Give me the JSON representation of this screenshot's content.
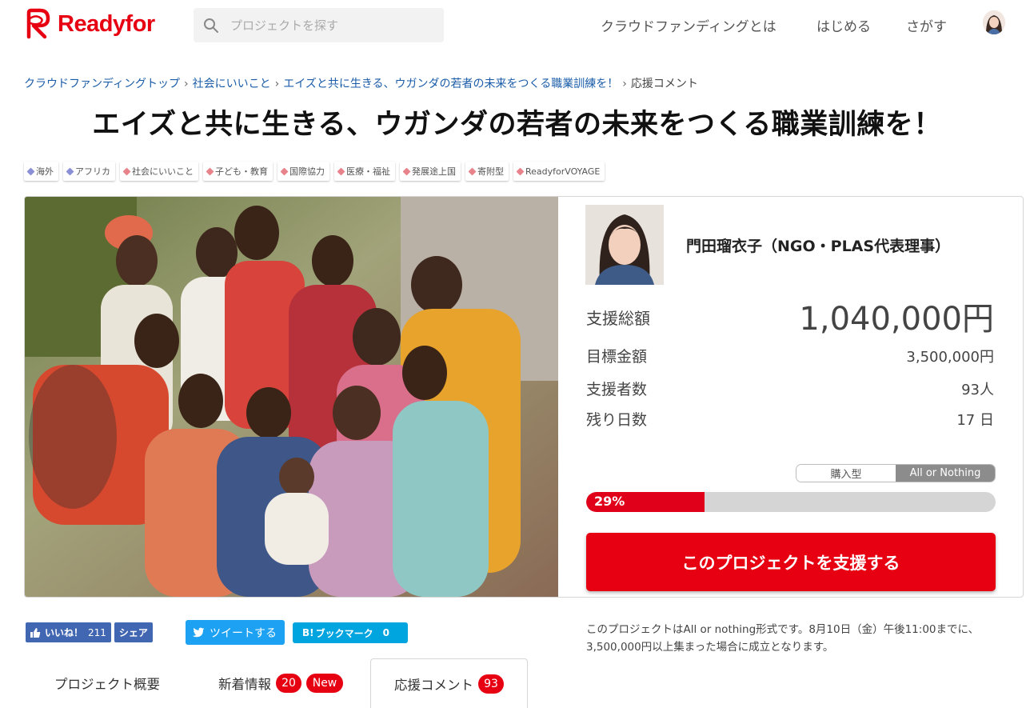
{
  "header": {
    "logo_text": "Readyfor",
    "search_placeholder": "プロジェクトを探す",
    "nav": [
      "クラウドファンディングとは",
      "はじめる",
      "さがす"
    ]
  },
  "breadcrumb": [
    "クラウドファンディングトップ",
    "社会にいいこと",
    "エイズと共に生きる、ウガンダの若者の未来をつくる職業訓練を！",
    "応援コメント"
  ],
  "title": "エイズと共に生きる、ウガンダの若者の未来をつくる職業訓練を！",
  "tags": [
    {
      "label": "海外",
      "color": "#8b8fd6"
    },
    {
      "label": "アフリカ",
      "color": "#8b8fd6"
    },
    {
      "label": "社会にいいこと",
      "color": "#e8838b"
    },
    {
      "label": "子ども・教育",
      "color": "#e8838b"
    },
    {
      "label": "国際協力",
      "color": "#e8838b"
    },
    {
      "label": "医療・福祉",
      "color": "#e8838b"
    },
    {
      "label": "発展途上国",
      "color": "#e8838b"
    },
    {
      "label": "寄附型",
      "color": "#e8838b"
    },
    {
      "label": "ReadyforVOYAGE",
      "color": "#e8838b"
    }
  ],
  "project": {
    "owner_name": "門田瑠衣子（NGO・PLAS代表理事）",
    "total_label": "支援総額",
    "total_value": "1,040,000円",
    "goal_label": "目標金額",
    "goal_value": "3,500,000円",
    "backers_label": "支援者数",
    "backers_value": "93人",
    "days_label": "残り日数",
    "days_value": "17 日",
    "type_options": [
      "購入型",
      "All or Nothing"
    ],
    "type_selected": "All or Nothing",
    "progress_label": "29%",
    "progress_fraction": 0.29,
    "support_button": "このプロジェクトを支援する"
  },
  "social": {
    "fb_like": "いいね！",
    "fb_like_count": "211",
    "fb_share": "シェア",
    "tweet": "ツイートする",
    "hatena": "ブックマーク",
    "hatena_count": "0"
  },
  "notice": "このプロジェクトはAll or nothing形式です。8月10日（金）午後11:00までに、3,500,000円以上集まった場合に成立となります。",
  "tabs": {
    "overview": "プロジェクト概要",
    "news": "新着情報",
    "news_count": "20",
    "news_new": "New",
    "comments": "応援コメント",
    "comments_count": "93"
  },
  "colors": {
    "brand": "#e60012",
    "link": "#1a5ca8",
    "facebook": "#4267b2",
    "twitter": "#1da1f2",
    "hatena": "#00a4de"
  }
}
